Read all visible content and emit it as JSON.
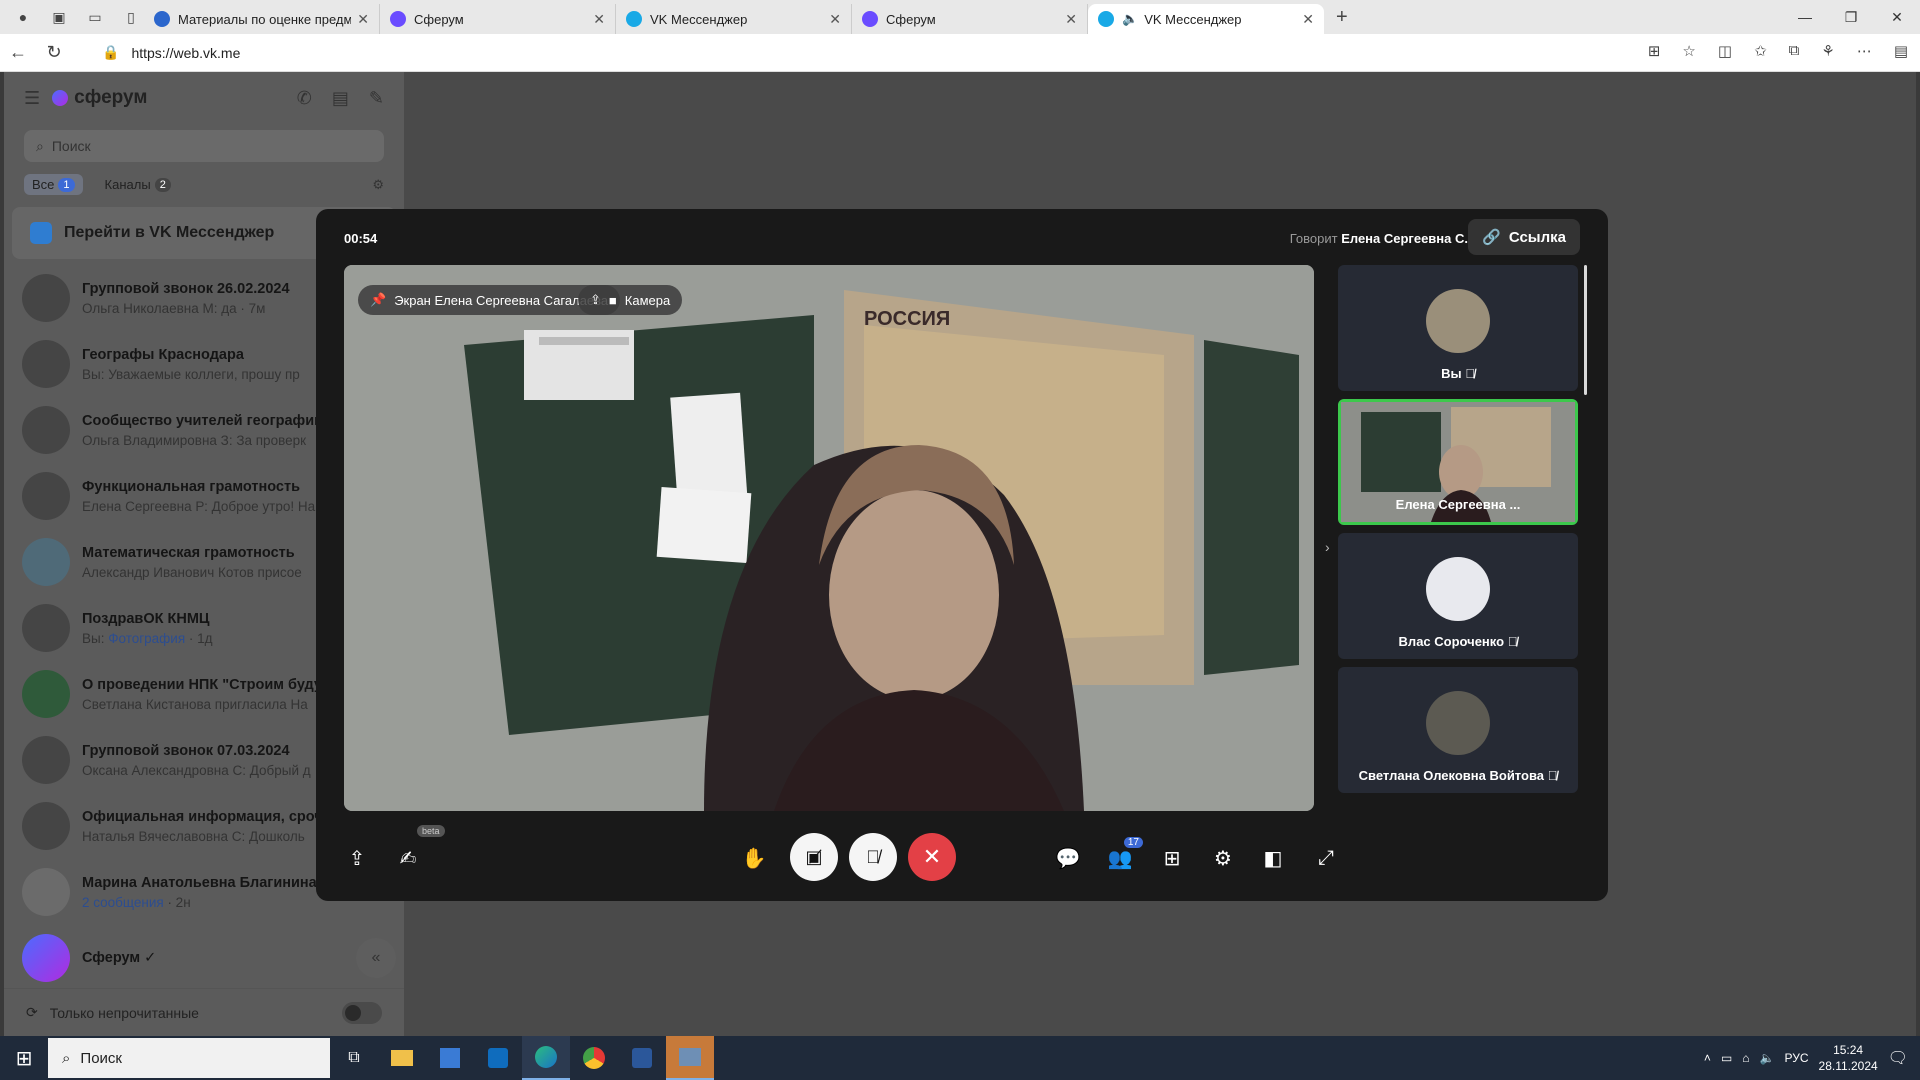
{
  "browser": {
    "tabs": [
      {
        "title": "Материалы по оценке предметн",
        "favicon_color": "#2b66cc"
      },
      {
        "title": "Сферум",
        "favicon_color": "#6a4cff"
      },
      {
        "title": "VK Мессенджер",
        "favicon_color": "#19a9e6"
      },
      {
        "title": "Сферум",
        "favicon_color": "#6a4cff"
      },
      {
        "title": "VK Мессенджер",
        "favicon_color": "#19a9e6",
        "active": true
      }
    ],
    "url": "https://web.vk.me"
  },
  "sidebar": {
    "app_name": "сферум",
    "search_placeholder": "Поиск",
    "filters": [
      {
        "label": "Все",
        "count": "1"
      },
      {
        "label": "Каналы",
        "count": "2"
      }
    ],
    "goto_label": "Перейти в VK Мессенджер",
    "chats": [
      {
        "title": "Групповой звонок 26.02.2024",
        "subtitle": "Ольга Николаевна М: да · 7м"
      },
      {
        "title": "Географы Краснодара",
        "subtitle": "Вы: Уважаемые коллеги, прошу пр"
      },
      {
        "title": "Сообщество учителей географии",
        "subtitle": "Ольга Владимировна З: За проверк"
      },
      {
        "title": "Функциональная грамотность",
        "subtitle": "Елена Сергеевна Р: Доброе утро! На"
      },
      {
        "title": "Математическая грамотность",
        "subtitle": "Александр Иванович Котов присое"
      },
      {
        "title": "ПоздравОК КНМЦ",
        "subtitle_prefix": "Вы: ",
        "subtitle_link": "Фотография",
        "subtitle_suffix": " · 1д"
      },
      {
        "title": "О проведении НПК \"Строим буду",
        "subtitle": "Светлана Кистанова пригласила На"
      },
      {
        "title": "Групповой звонок 07.03.2024",
        "subtitle": "Оксана Александровна С: Добрый д"
      },
      {
        "title": "Официальная информация, сроч",
        "subtitle": "Наталья Вячеславовна С: Дошколь"
      },
      {
        "title": "Марина Анатольевна Благинина",
        "subtitle_link": "2 сообщения",
        "subtitle_suffix": " · 2н"
      },
      {
        "title": "Сферум ✓",
        "subtitle": ""
      }
    ],
    "unread_only_label": "Только непрочитанные"
  },
  "call": {
    "timer": "00:54",
    "speaking_prefix": "Говорит",
    "speaking_name": "Елена Сергеевна С.",
    "link_label": "Ссылка",
    "screen_label": "Экран Елена Сергеевна Сагалаева",
    "camera_label": "Камера",
    "participants": [
      {
        "name": "Вы"
      },
      {
        "name": "Елена Сергеевна ...",
        "active": true
      },
      {
        "name": "Влас Сороченко"
      },
      {
        "name": "Светлана Олековна Войтова"
      }
    ],
    "beta_label": "beta",
    "participants_count": "17"
  },
  "taskbar": {
    "search_label": "Поиск",
    "lang": "РУС",
    "time": "15:24",
    "date": "28.11.2024"
  },
  "colors": {
    "accent": "#3d6ad6",
    "active_tile_border": "#3cc84c",
    "end_call": "#e34046"
  }
}
